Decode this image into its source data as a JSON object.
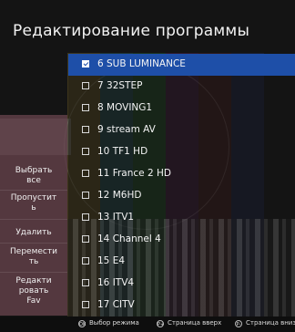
{
  "header": {
    "title": "Редактирование программы"
  },
  "actions": [
    {
      "label": "Выбрать все",
      "id": "select-all"
    },
    {
      "label": "Пропустить",
      "id": "skip"
    },
    {
      "label": "Удалить",
      "id": "delete"
    },
    {
      "label": "Переместить",
      "id": "move"
    },
    {
      "label": "Редактировать Fav",
      "id": "edit-fav"
    }
  ],
  "action_lines": {
    "select_all": [
      "Выбрать",
      "все"
    ],
    "skip": [
      "Пропустит",
      "ь"
    ],
    "delete": [
      "Удалить"
    ],
    "move": [
      "Перемести",
      "ть"
    ],
    "edit_fav": [
      "Редакти",
      "ровать",
      "Fav"
    ]
  },
  "channels": [
    {
      "label": "6 SUB LUMINANCE",
      "checked": true,
      "highlighted": true
    },
    {
      "label": "7 32STEP",
      "checked": false
    },
    {
      "label": "8 MOVING1",
      "checked": false
    },
    {
      "label": "9 stream AV",
      "checked": false
    },
    {
      "label": "10 TF1 HD",
      "checked": false
    },
    {
      "label": "11 France 2 HD",
      "checked": false
    },
    {
      "label": "12 M6HD",
      "checked": false
    },
    {
      "label": "13 ITV1",
      "checked": false
    },
    {
      "label": "14 Channel 4",
      "checked": false
    },
    {
      "label": "15 E4",
      "checked": false
    },
    {
      "label": "16 ITV4",
      "checked": false
    },
    {
      "label": "17 CITV",
      "checked": false
    }
  ],
  "footer": {
    "hints": [
      {
        "key": "OK",
        "label": "Выбор режима"
      },
      {
        "key": "P+",
        "label": "Страница вверх"
      },
      {
        "key": "P-",
        "label": "Страница вниз"
      }
    ]
  },
  "colors": {
    "highlight": "#1e4fa8",
    "side_panel": "#6e4650"
  }
}
